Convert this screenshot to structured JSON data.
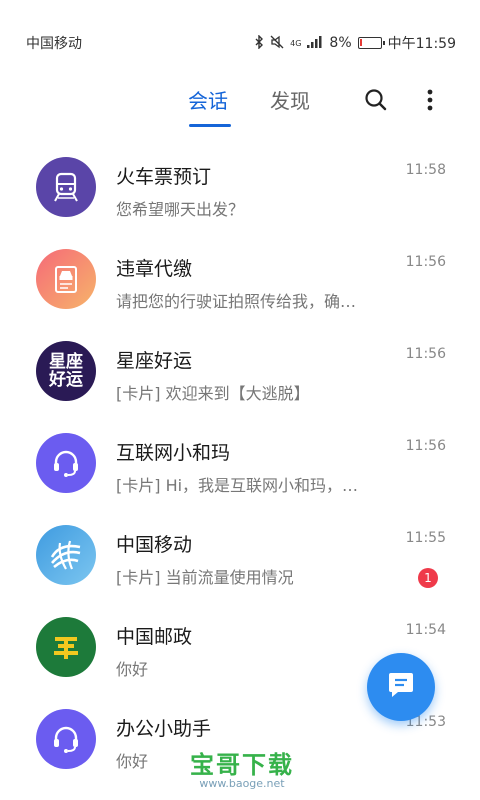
{
  "status_bar": {
    "carrier": "中国移动",
    "network": "4G",
    "battery_percent": "8%",
    "battery_level": 0.08,
    "time": "中午11:59"
  },
  "tabs": [
    {
      "label": "会话",
      "active": true
    },
    {
      "label": "发现",
      "active": false
    }
  ],
  "icons": {
    "search": "search-icon",
    "more": "more-vertical-icon",
    "fab": "chat-compose-icon"
  },
  "conversations": [
    {
      "title": "火车票预订",
      "subtitle": "您希望哪天出发？",
      "time": "11:58",
      "avatar_icon": "train-icon",
      "avatar_color": "#5a45a8"
    },
    {
      "title": "违章代缴",
      "subtitle": "请把您的行驶证拍照传给我，确…",
      "time": "11:56",
      "avatar_icon": "car-license-icon",
      "avatar_color": "#f28a6a"
    },
    {
      "title": "星座好运",
      "subtitle": "[卡片] 欢迎来到【大逃脱】",
      "time": "11:56",
      "avatar_icon": "horoscope-logo",
      "avatar_text_1": "星座",
      "avatar_text_2": "好运",
      "avatar_color": "#2a1a55"
    },
    {
      "title": "互联网小和玛",
      "subtitle": "[卡片] Hi，我是互联网小和玛，…",
      "time": "11:56",
      "avatar_icon": "headset-icon",
      "avatar_color": "#6b5cf0"
    },
    {
      "title": "中国移动",
      "subtitle": "[卡片] 当前流量使用情况",
      "time": "11:55",
      "avatar_icon": "china-mobile-logo",
      "avatar_color": "#3f9be0",
      "badge": "1"
    },
    {
      "title": "中国邮政",
      "subtitle": "你好",
      "time": "11:54",
      "avatar_icon": "china-post-logo",
      "avatar_color": "#1d7a3a"
    },
    {
      "title": "办公小助手",
      "subtitle": "你好",
      "time": "11:53",
      "avatar_icon": "headset-icon",
      "avatar_color": "#6b5cf0"
    }
  ],
  "watermark": {
    "title": "宝哥下载",
    "url": "www.baoge.net"
  }
}
